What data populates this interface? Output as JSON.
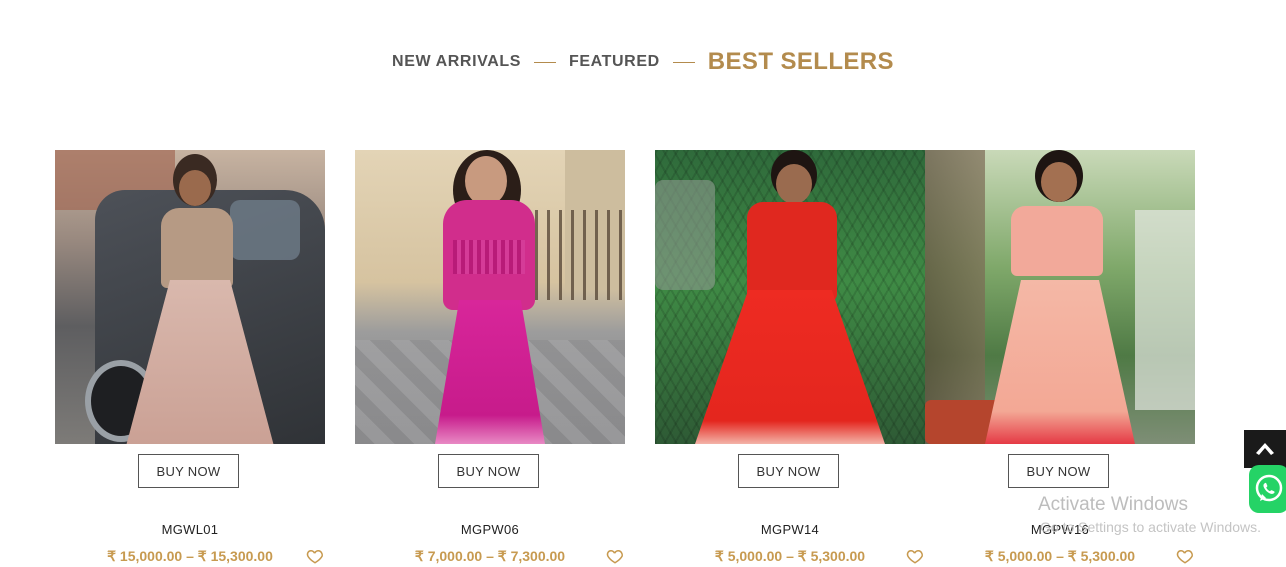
{
  "tabs": [
    {
      "label": "NEW ARRIVALS",
      "active": false
    },
    {
      "label": "FEATURED",
      "active": false
    },
    {
      "label": "BEST SELLERS",
      "active": true
    }
  ],
  "products": [
    {
      "sku": "MGWL01",
      "price": "₹ 15,000.00 – ₹ 15,300.00",
      "buy_label": "BUY NOW"
    },
    {
      "sku": "MGPW06",
      "price": "₹ 7,000.00 – ₹ 7,300.00",
      "buy_label": "BUY NOW"
    },
    {
      "sku": "MGPW14",
      "price": "₹ 5,000.00 – ₹ 5,300.00",
      "buy_label": "BUY NOW"
    },
    {
      "sku": "MGPW16",
      "price": "₹ 5,000.00 – ₹ 5,300.00",
      "buy_label": "BUY NOW"
    }
  ],
  "watermark": {
    "title": "Activate Windows",
    "subtitle": "Go to Settings to activate Windows."
  },
  "icons": {
    "wishlist": "heart-icon",
    "back_to_top": "chevron-up-icon",
    "chat": "whatsapp-icon"
  },
  "colors": {
    "accent": "#b38b4d",
    "price": "#c79a50"
  }
}
